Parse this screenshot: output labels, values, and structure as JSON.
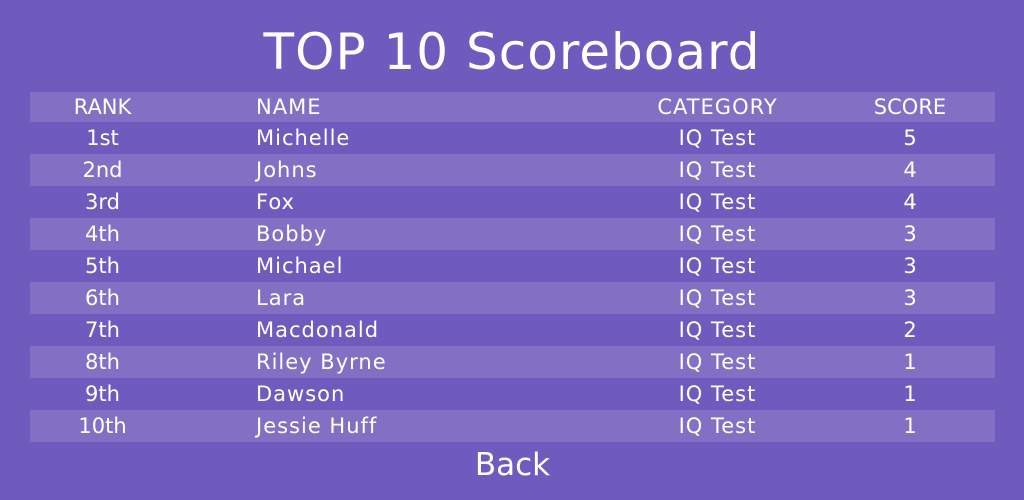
{
  "title": "TOP 10 Scoreboard",
  "colors": {
    "background": "#6f5bbd",
    "row_stripe": "#8370c4",
    "text": "#ffffff"
  },
  "table": {
    "headers": {
      "rank": "RANK",
      "name": "NAME",
      "category": "CATEGORY",
      "score": "SCORE"
    },
    "rows": [
      {
        "rank": "1st",
        "name": "Michelle",
        "category": "IQ Test",
        "score": "5"
      },
      {
        "rank": "2nd",
        "name": "Johns",
        "category": "IQ Test",
        "score": "4"
      },
      {
        "rank": "3rd",
        "name": "Fox",
        "category": "IQ Test",
        "score": "4"
      },
      {
        "rank": "4th",
        "name": "Bobby",
        "category": "IQ Test",
        "score": "3"
      },
      {
        "rank": "5th",
        "name": "Michael",
        "category": "IQ Test",
        "score": "3"
      },
      {
        "rank": "6th",
        "name": "Lara",
        "category": "IQ Test",
        "score": "3"
      },
      {
        "rank": "7th",
        "name": "Macdonald",
        "category": "IQ Test",
        "score": "2"
      },
      {
        "rank": "8th",
        "name": "Riley Byrne",
        "category": "IQ Test",
        "score": "1"
      },
      {
        "rank": "9th",
        "name": "Dawson",
        "category": "IQ Test",
        "score": "1"
      },
      {
        "rank": "10th",
        "name": "Jessie Huff",
        "category": "IQ Test",
        "score": "1"
      }
    ]
  },
  "back_label": "Back"
}
